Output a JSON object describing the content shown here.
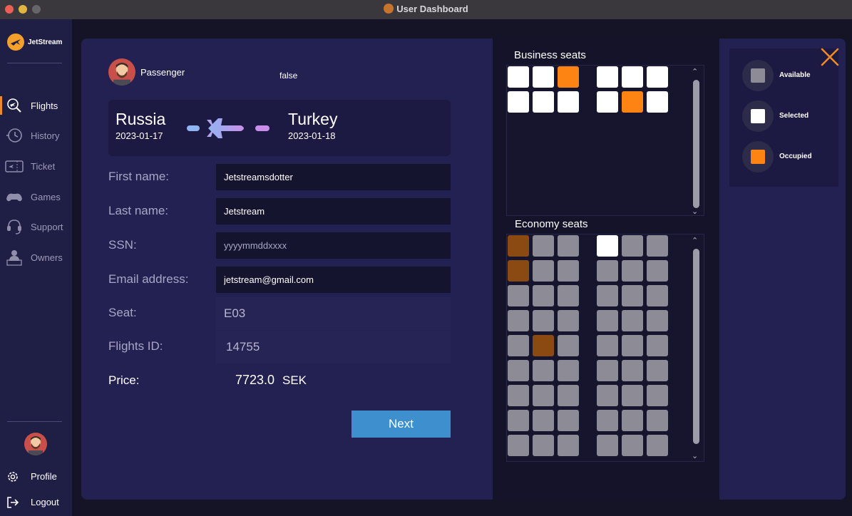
{
  "window": {
    "title": "User Dashboard"
  },
  "brand": {
    "name": "JetStream"
  },
  "nav": {
    "items": [
      {
        "label": "Flights",
        "icon": "flights-search-icon",
        "active": true
      },
      {
        "label": "History",
        "icon": "history-icon",
        "active": false
      },
      {
        "label": "Ticket",
        "icon": "ticket-icon",
        "active": false
      },
      {
        "label": "Games",
        "icon": "games-icon",
        "active": false
      },
      {
        "label": "Support",
        "icon": "support-icon",
        "active": false
      },
      {
        "label": "Owners",
        "icon": "owners-icon",
        "active": false
      }
    ],
    "profile_label": "Profile",
    "logout_label": "Logout"
  },
  "passenger": {
    "label": "Passenger",
    "flag_text": "false"
  },
  "route": {
    "from": "Russia",
    "from_date": "2023-01-17",
    "to": "Turkey",
    "to_date": "2023-01-18"
  },
  "form": {
    "first_name": {
      "label": "First name:",
      "value": "Jetstreamsdotter"
    },
    "last_name": {
      "label": "Last name:",
      "value": "Jetstream"
    },
    "ssn": {
      "label": "SSN:",
      "value": "",
      "placeholder": "yyyymmddxxxx"
    },
    "email": {
      "label": "Email address:",
      "value": "jetstream@gmail.com"
    },
    "seat": {
      "label": "Seat:",
      "value": "E03"
    },
    "flight_id": {
      "label": "Flights ID:",
      "value": "14755"
    },
    "price": {
      "label": "Price:",
      "value": "7723.0",
      "currency": "SEK"
    },
    "next_label": "Next"
  },
  "seats": {
    "business_title": "Business seats",
    "economy_title": "Economy seats",
    "business_rows": [
      [
        "available_white",
        "available_white",
        "occupied",
        "available_white",
        "available_white",
        "available_white"
      ],
      [
        "available_white",
        "available_white",
        "available_white",
        "available_white",
        "occupied",
        "available_white"
      ]
    ],
    "economy_rows": [
      [
        "occupied",
        "available",
        "available",
        "selected",
        "available",
        "available"
      ],
      [
        "occupied",
        "available",
        "available",
        "available",
        "available",
        "available"
      ],
      [
        "available",
        "available",
        "available",
        "available",
        "available",
        "available"
      ],
      [
        "available",
        "available",
        "available",
        "available",
        "available",
        "available"
      ],
      [
        "available",
        "occupied",
        "available",
        "available",
        "available",
        "available"
      ],
      [
        "available",
        "available",
        "available",
        "available",
        "available",
        "available"
      ],
      [
        "available",
        "available",
        "available",
        "available",
        "available",
        "available"
      ],
      [
        "available",
        "available",
        "available",
        "available",
        "available",
        "available"
      ],
      [
        "available",
        "available",
        "available",
        "available",
        "available",
        "available"
      ]
    ]
  },
  "legend": {
    "available": {
      "label": "Available",
      "color": "#8d8c96"
    },
    "selected": {
      "label": "Selected",
      "color": "#ffffff"
    },
    "occupied": {
      "label": "Occupied",
      "color": "#fd8412"
    }
  },
  "colors": {
    "accent": "#f08a24",
    "button": "#3d8fce",
    "occupied": "#fd8412"
  }
}
